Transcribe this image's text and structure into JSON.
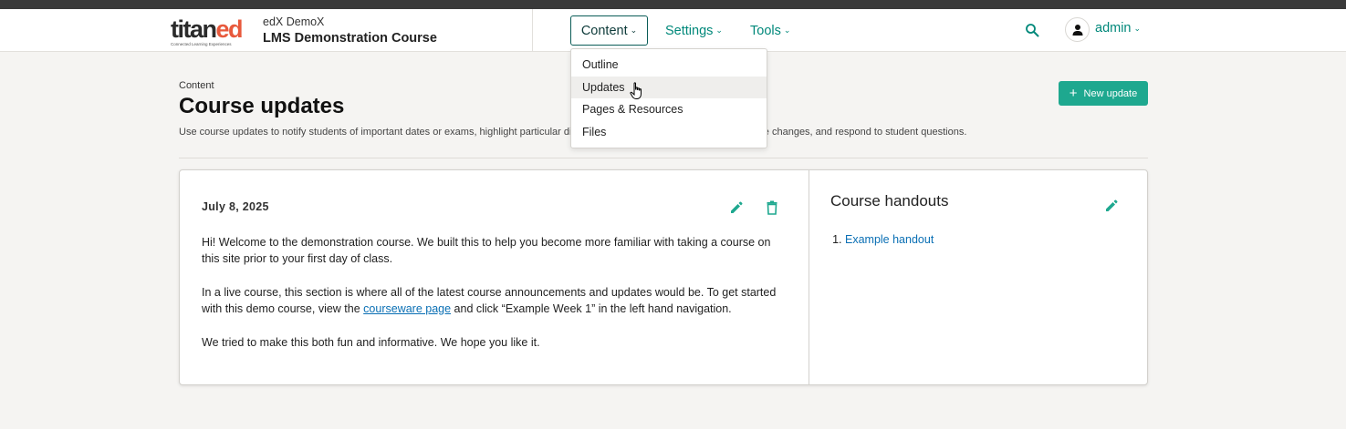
{
  "brand": {
    "logo_main": "titan",
    "logo_accent": "ed",
    "logo_tagline": "Connected Learning Experiences",
    "accent_color": "#00887a",
    "button_color": "#1ea88f",
    "logo_accent_color": "#e8593c"
  },
  "header": {
    "course_org": "edX DemoX",
    "course_name": "LMS Demonstration Course",
    "nav": {
      "content_label": "Content",
      "settings_label": "Settings",
      "tools_label": "Tools"
    },
    "search_icon": "search-icon",
    "user": {
      "avatar_icon": "user-icon",
      "name": "admin"
    }
  },
  "content_menu": {
    "items": [
      "Outline",
      "Updates",
      "Pages & Resources",
      "Files"
    ],
    "hovered": "Updates"
  },
  "page": {
    "breadcrumb": "Content",
    "title": "Course updates",
    "description": "Use course updates to notify students of important dates or exams, highlight particular discussions in the forums, announce schedule changes, and respond to student questions.",
    "new_update_label": "New update"
  },
  "update": {
    "date": "July 8, 2025",
    "p1": "Hi! Welcome to the demonstration course. We built this to help you become more familiar with taking a course on this site prior to your first day of class.",
    "p2_before": "In a live course, this section is where all of the latest course announcements and updates would be. To get started with this demo course, view the ",
    "p2_link": "courseware page",
    "p2_after": " and click “Example Week 1” in the left hand navigation.",
    "p3": "We tried to make this both fun and informative. We hope you like it."
  },
  "handouts": {
    "title": "Course handouts",
    "items": [
      "Example handout"
    ]
  }
}
